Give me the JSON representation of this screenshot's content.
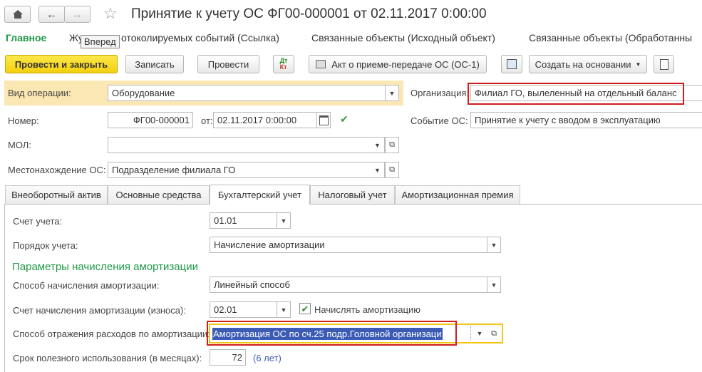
{
  "window": {
    "title": "Принятие к учету ОС ФГ00-000001 от 02.11.2017 0:00:00",
    "tooltip": "Вперед"
  },
  "navbar": {
    "items": [
      "Главное",
      "Журнал регистрации протоколируемых событий (Ссылка)",
      "Связанные объекты (Исходный объект)",
      "Связанные объекты (Обработанный объект)"
    ],
    "item1_prefix": "Жу",
    "item1_suffix": "отоколируемых событий (Ссылка)",
    "item3_visible": "Связанные объекты (Обработанны"
  },
  "toolbar": {
    "post_and_close": "Провести и закрыть",
    "write": "Записать",
    "post": "Провести",
    "dt_label": "Дт",
    "kt_label": "Кт",
    "act": "Акт о приеме-передаче ОС (ОС-1)",
    "create_based_on": "Создать на основании"
  },
  "header": {
    "operation_type_label": "Вид операции:",
    "operation_type_value": "Оборудование",
    "organization_label": "Организация:",
    "organization_value": "Филиал ГО, вылеленный на отдельный баланс",
    "number_label": "Номер:",
    "number_value": "ФГ00-000001",
    "date_label": "от:",
    "date_value": "02.11.2017  0:00:00",
    "event_label": "Событие ОС:",
    "event_value": "Принятие к учету с вводом в эксплуатацию",
    "mol_label": "МОЛ:",
    "mol_value": "",
    "location_label": "Местонахождение ОС:",
    "location_value": "Подразделение филиала ГО"
  },
  "tabs": [
    {
      "label": "Внеоборотный актив",
      "active": false
    },
    {
      "label": "Основные средства",
      "active": false
    },
    {
      "label": "Бухгалтерский учет",
      "active": true
    },
    {
      "label": "Налоговый учет",
      "active": false
    },
    {
      "label": "Амортизационная премия",
      "active": false
    }
  ],
  "accounting": {
    "account_label": "Счет учета:",
    "account_value": "01.01",
    "order_label": "Порядок учета:",
    "order_value": "Начисление амортизации",
    "section_title": "Параметры начисления амортизации",
    "method_label": "Способ начисления амортизации:",
    "method_value": "Линейный способ",
    "depr_account_label": "Счет начисления амортизации (износа):",
    "depr_account_value": "02.01",
    "accrue_label": "Начислять амортизацию",
    "accrue_checked": true,
    "expense_label": "Способ отражения расходов по амортизации:",
    "expense_value": "Амортизация ОС по сч.25 подр.Головной организаци",
    "life_label": "Срок полезного использования (в месяцах):",
    "life_value": "72",
    "life_years": "(6 лет)"
  },
  "colors": {
    "accent_green": "#1f9a47",
    "button_yellow": "#f8dc2a",
    "highlight_red": "#d21d1d",
    "selection_blue": "#3b5bb5",
    "focus_yellow": "#f2c415"
  }
}
